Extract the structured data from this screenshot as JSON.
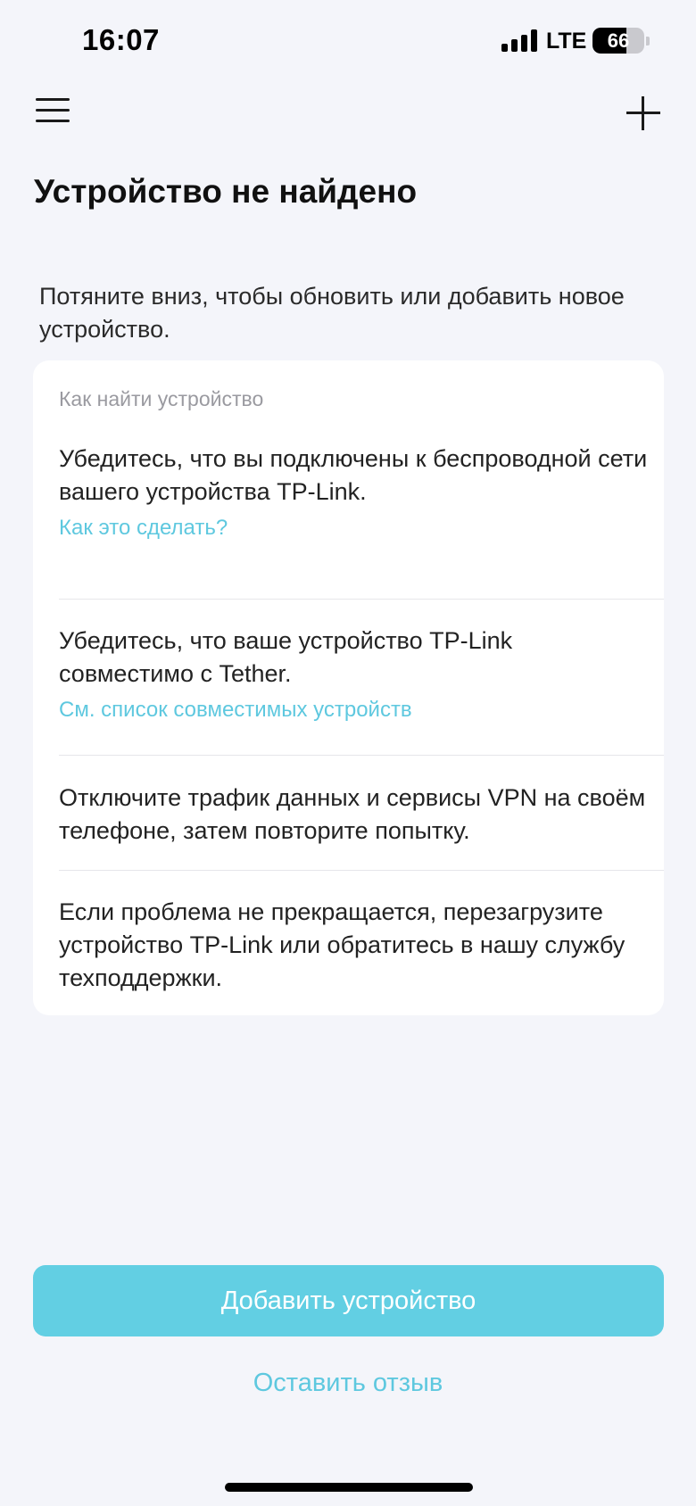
{
  "status_bar": {
    "time": "16:07",
    "network": "LTE",
    "battery_level": "66",
    "battery_fraction": 0.66,
    "icons": [
      "signal-bars-icon",
      "battery-icon"
    ]
  },
  "nav": {
    "menu_icon": "hamburger-menu-icon",
    "add_icon": "plus-icon"
  },
  "page": {
    "title": "Устройство не найдено",
    "subtitle": "Потяните вниз, чтобы обновить или добавить новое устройство."
  },
  "card": {
    "header": "Как найти устройство",
    "tips": [
      {
        "text": "Убедитесь, что вы подключены к беспроводной сети вашего устройства TP-Link.",
        "link": "Как это сделать?"
      },
      {
        "text": "Убедитесь, что ваше устройство TP-Link совместимо с Tether.",
        "link": "См. список совместимых устройств"
      },
      {
        "text": "Отключите трафик данных и сервисы VPN на своём телефоне, затем повторите попытку."
      },
      {
        "text": "Если проблема не прекращается, перезагрузите устройство TP-Link или обратитесь в нашу службу техподдержки."
      }
    ]
  },
  "actions": {
    "add_device": "Добавить устройство",
    "feedback": "Оставить отзыв"
  },
  "colors": {
    "accent": "#5ec8df",
    "button": "#62cfe3",
    "background": "#f4f5fa"
  }
}
